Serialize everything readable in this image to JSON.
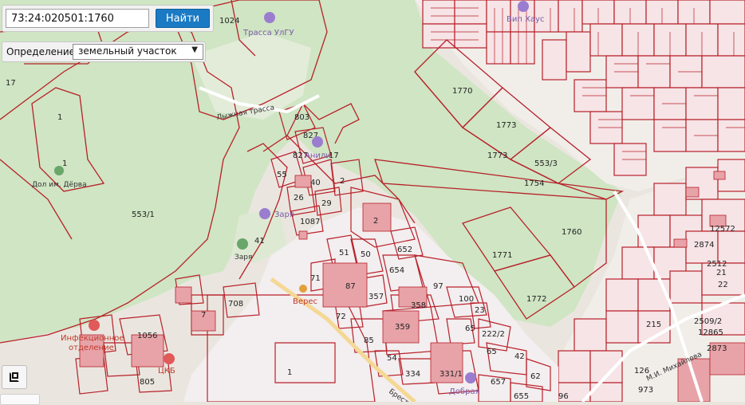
{
  "search": {
    "value": "73:24:020501:1760",
    "button_label": "Найти"
  },
  "definition": {
    "label": "Определение:",
    "selected": "земельный участок",
    "arrow_icon": "chevron-down-icon"
  },
  "map_controls": {
    "fullscreen_icon": "fullscreen-icon"
  },
  "colors": {
    "parcel_border": "#b8202a",
    "park_green": "#cfe5c3",
    "urban": "#eae6df",
    "building": "#e7a3a8",
    "poi_purple": "#7a5aa8",
    "search_button": "#1b7ac4"
  },
  "parcel_labels": [
    "1770",
    "1773",
    "1773",
    "553/3",
    "1754",
    "1760",
    "1771",
    "1772",
    "553/1",
    "1",
    "1",
    "17",
    "1024",
    "803",
    "827",
    "827",
    "17",
    "55",
    "40",
    "26",
    "2",
    "29",
    "1087",
    "2",
    "41",
    "51",
    "50",
    "652",
    "654",
    "97",
    "100",
    "71",
    "87",
    "357",
    "358",
    "359",
    "23",
    "72",
    "85",
    "65",
    "222/2",
    "42",
    "62",
    "1056",
    "708",
    "7",
    "805",
    "1",
    "334",
    "331/1",
    "657",
    "655",
    "96",
    "973",
    "2874",
    "2873",
    "126",
    "2509/2",
    "12865",
    "215",
    "12572",
    "2512",
    "21",
    "22",
    "65",
    "54"
  ],
  "poi_labels": [
    "Трасса УлГУ",
    "Вип Хаус",
    "Анили",
    "Заря",
    "Заря",
    "Дол им. Дёрва",
    "Верес",
    "Инфекционное отделение",
    "ЦКБ",
    "Добрая"
  ],
  "road_labels": [
    "Лыжная трасса",
    "Брестская",
    "М.И. Михайлова"
  ]
}
